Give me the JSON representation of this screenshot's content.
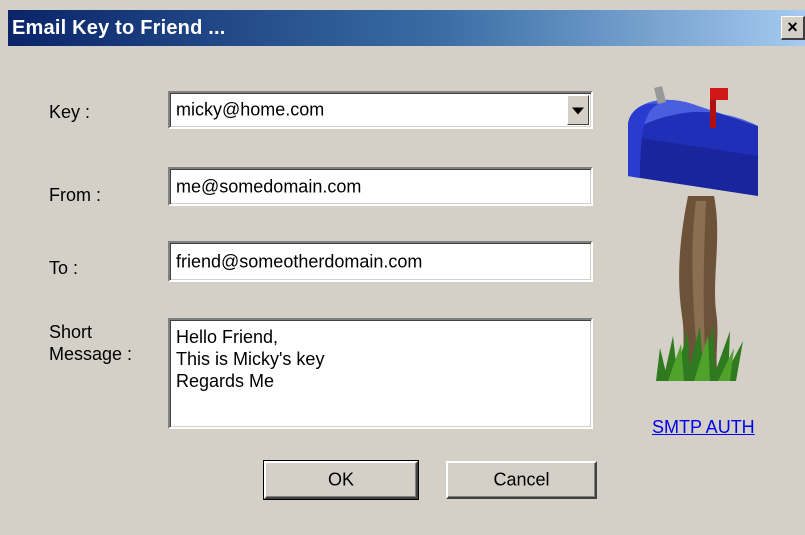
{
  "window": {
    "title": "Email Key to Friend ...",
    "close_glyph": "×"
  },
  "form": {
    "key_label": "Key :",
    "key_value": "micky@home.com",
    "from_label": "From :",
    "from_value": "me@somedomain.com",
    "to_label": "To :",
    "to_value": "friend@someotherdomain.com",
    "message_label_line1": "Short",
    "message_label_line2": "Message :",
    "message_value": "Hello Friend,\nThis is Micky's key\nRegards Me"
  },
  "buttons": {
    "ok_label": "OK",
    "cancel_label": "Cancel"
  },
  "side": {
    "image_icon": "mailbox-icon",
    "link_label": "SMTP AUTH"
  },
  "colors": {
    "titlebar_start": "#0a246a",
    "titlebar_end": "#a6caf0",
    "dialog_bg": "#d4d0c8",
    "link": "#0000ee"
  }
}
